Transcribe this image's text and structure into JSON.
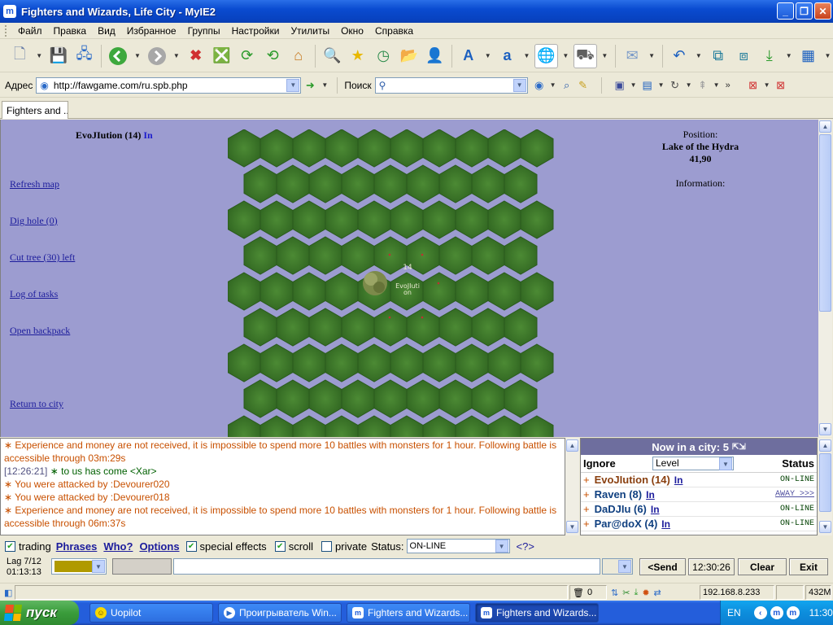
{
  "window": {
    "title": "Fighters and Wizards, Life City - MyIE2",
    "min": "_",
    "max": "❐",
    "close": "✕"
  },
  "menu": [
    "Файл",
    "Правка",
    "Вид",
    "Избранное",
    "Группы",
    "Настройки",
    "Утилиты",
    "Окно",
    "Справка"
  ],
  "address": {
    "label": "Адрес",
    "url": "http://fawgame.com/ru.spb.php"
  },
  "search": {
    "label": "Поиск",
    "value": ""
  },
  "tab": {
    "label": "Fighters and ..."
  },
  "game": {
    "player_name": "EvoJIution (14)",
    "player_in": "In",
    "links": [
      "Refresh map",
      "Dig hole (0)",
      "Cut tree (30) left",
      "Log of tasks",
      "Open backpack",
      "Return to city"
    ],
    "position_label": "Position:",
    "location": "Lake of the Hydra",
    "coords": "41,90",
    "information_label": "Information:",
    "token_level": "14",
    "token_name_1": "EvoJIuti",
    "token_name_2": "on"
  },
  "chat": {
    "lines": [
      {
        "kind": "warn",
        "text": "Experience and money are not received, it is impossible to spend more 10 battles with monsters for 1 hour. Following battle is accessible through 03m:29s"
      },
      {
        "kind": "sys",
        "time": "[12:26:21]",
        "text": "to us has come",
        "who": "<Xar>"
      },
      {
        "kind": "warn",
        "text": "You were attacked by :Devourer020"
      },
      {
        "kind": "warn",
        "text": "You were attacked by :Devourer018"
      },
      {
        "kind": "warn",
        "text": "Experience and money are not received, it is impossible to spend more 10 battles with monsters for 1 hour. Following battle is accessible through 06m:37s"
      }
    ]
  },
  "online": {
    "header": "Now in a city: 5",
    "ignore": "Ignore",
    "level": "Level",
    "status": "Status",
    "users": [
      {
        "name": "EvoJIution (14)",
        "in": "In",
        "status": "ON-LINE"
      },
      {
        "name": "Raven (8)",
        "in": "In",
        "status": "AWAY >>>"
      },
      {
        "name": "DaDJIu (6)",
        "in": "In",
        "status": "ON-LINE"
      },
      {
        "name": "Par@doX (4)",
        "in": "In",
        "status": "ON-LINE"
      }
    ]
  },
  "options": {
    "trading": "trading",
    "phrases": "Phrases",
    "who": "Who?",
    "options": "Options",
    "special_effects": "special effects",
    "scroll": "scroll",
    "private": "private",
    "status_label": "Status:",
    "status_value": "ON-LINE",
    "help": "<?>"
  },
  "send": {
    "lag": "Lag 7/12",
    "timer": "01:13:13",
    "send_label": "<Send",
    "time": "12:30:26",
    "clear": "Clear",
    "exit": "Exit"
  },
  "statusbar": {
    "trash": "0",
    "ip": "192.168.8.233",
    "mem": "432M"
  },
  "taskbar": {
    "start": "пуск",
    "tasks": [
      "Uopilot",
      "Проигрыватель Win...",
      "Fighters and Wizards...",
      "Fighters and Wizards..."
    ],
    "lang": "EN",
    "clock": "11:30"
  }
}
